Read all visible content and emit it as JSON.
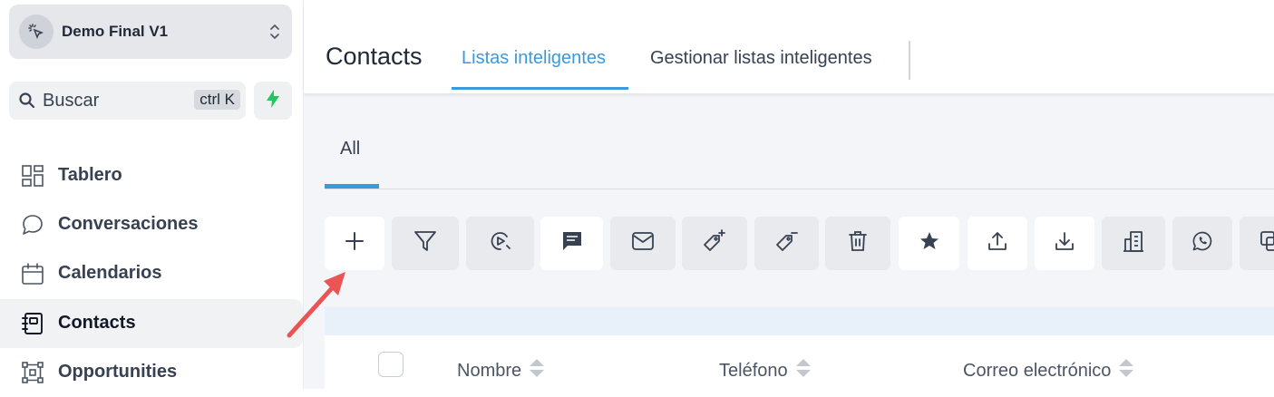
{
  "workspace": {
    "name": "Demo Final V1",
    "icon": "cursor-click-icon",
    "switcher_icon": "chevron-updown-icon"
  },
  "search": {
    "placeholder": "Buscar",
    "shortcut": "ctrl K",
    "icon": "search-icon"
  },
  "quick_action_icon": "bolt-icon",
  "sidebar": {
    "items": [
      {
        "label": "Tablero",
        "icon": "dashboard-icon",
        "active": false
      },
      {
        "label": "Conversaciones",
        "icon": "chat-bubble-icon",
        "active": false
      },
      {
        "label": "Calendarios",
        "icon": "calendar-icon",
        "active": false
      },
      {
        "label": "Contacts",
        "icon": "contacts-book-icon",
        "active": true
      },
      {
        "label": "Opportunities",
        "icon": "opportunities-icon",
        "active": false
      }
    ]
  },
  "header": {
    "title": "Contacts",
    "tabs": [
      {
        "label": "Listas inteligentes",
        "active": true
      },
      {
        "label": "Gestionar listas inteligentes",
        "active": false
      }
    ]
  },
  "subtabs": [
    {
      "label": "All",
      "active": true
    }
  ],
  "toolbar": {
    "buttons": [
      {
        "name": "add-contact",
        "icon": "plus-icon",
        "style": "light"
      },
      {
        "name": "filter",
        "icon": "filter-icon",
        "style": "gray"
      },
      {
        "name": "add-to-workflow",
        "icon": "workflow-play-icon",
        "style": "gray"
      },
      {
        "name": "send-sms",
        "icon": "message-icon",
        "style": "light"
      },
      {
        "name": "send-email",
        "icon": "mail-icon",
        "style": "gray"
      },
      {
        "name": "add-tag",
        "icon": "tag-plus-icon",
        "style": "gray"
      },
      {
        "name": "remove-tag",
        "icon": "tag-minus-icon",
        "style": "gray"
      },
      {
        "name": "delete",
        "icon": "trash-icon",
        "style": "gray"
      },
      {
        "name": "review-request",
        "icon": "star-icon",
        "style": "light"
      },
      {
        "name": "export",
        "icon": "upload-icon",
        "style": "light"
      },
      {
        "name": "import",
        "icon": "download-icon",
        "style": "light"
      },
      {
        "name": "company",
        "icon": "building-icon",
        "style": "gray"
      },
      {
        "name": "whatsapp",
        "icon": "whatsapp-icon",
        "style": "gray"
      },
      {
        "name": "merge",
        "icon": "copy-icon",
        "style": "gray"
      }
    ]
  },
  "table": {
    "columns": [
      {
        "label": "Nombre"
      },
      {
        "label": "Teléfono"
      },
      {
        "label": "Correo electrónico"
      }
    ]
  },
  "colors": {
    "accent": "#3b9ad9",
    "annotation_arrow": "#ea5455",
    "bolt": "#22c55e"
  }
}
